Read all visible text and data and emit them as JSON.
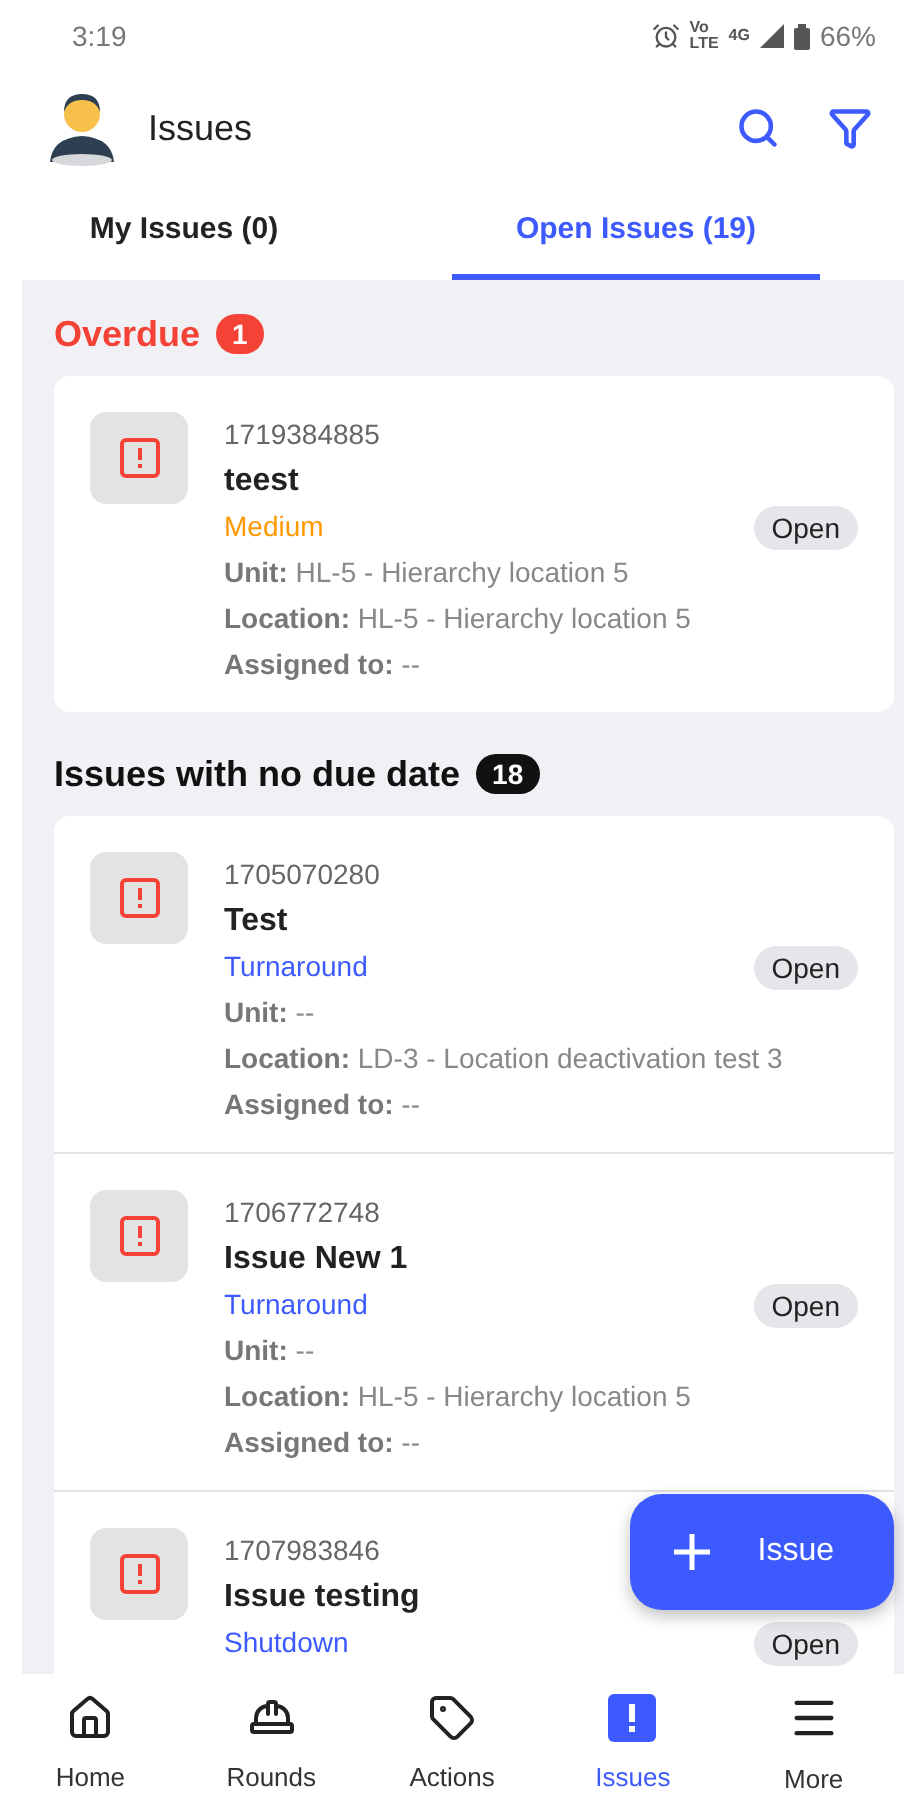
{
  "status_bar": {
    "time": "3:19",
    "network_top": "Vo",
    "network_bottom": "LTE",
    "network_type": "4G",
    "battery": "66%"
  },
  "header": {
    "title": "Issues"
  },
  "tabs": [
    {
      "label": "My Issues (0)",
      "selected": false
    },
    {
      "label": "Open Issues (19)",
      "selected": true
    }
  ],
  "sections": [
    {
      "kind": "overdue",
      "title": "Overdue",
      "count": "1",
      "issues": [
        {
          "id": "1719384885",
          "title": "teest",
          "tag": "Medium",
          "color": "#ff9800",
          "status": "Open",
          "lines": [
            "**Unit:** HL-5 - Hierarchy location 5",
            "**Location:** HL-5 - Hierarchy location 5",
            "**Assigned to:** --"
          ]
        }
      ]
    },
    {
      "kind": "plain",
      "title": "Issues with no due date",
      "count": "18",
      "issues": [
        {
          "id": "1705070280",
          "title": "Test",
          "tag": "Turnaround",
          "color": "#3d5afe",
          "status": "Open",
          "lines": [
            "**Unit:** --",
            "**Location:** LD-3 - Location deactivation test 3",
            "**Assigned to:** --"
          ]
        },
        {
          "id": "1706772748",
          "title": "Issue New 1",
          "tag": "Turnaround",
          "color": "#3d5afe",
          "status": "Open",
          "lines": [
            "**Unit:** --",
            "**Location:** HL-5 - Hierarchy location 5",
            "**Assigned to:** --"
          ]
        },
        {
          "id": "1707983846",
          "title": "Issue testing",
          "tag": "Shutdown",
          "color": "#3d5afe",
          "status": "Open"
        }
      ]
    }
  ],
  "fab": {
    "label": "Issue"
  },
  "nav": [
    {
      "kind": "home",
      "label": "Home",
      "selected": false
    },
    {
      "kind": "rounds",
      "label": "Rounds",
      "selected": false
    },
    {
      "kind": "actions",
      "label": "Actions",
      "selected": false
    },
    {
      "kind": "issues",
      "label": "Issues",
      "selected": true
    },
    {
      "kind": "more",
      "label": "More",
      "selected": false
    }
  ]
}
